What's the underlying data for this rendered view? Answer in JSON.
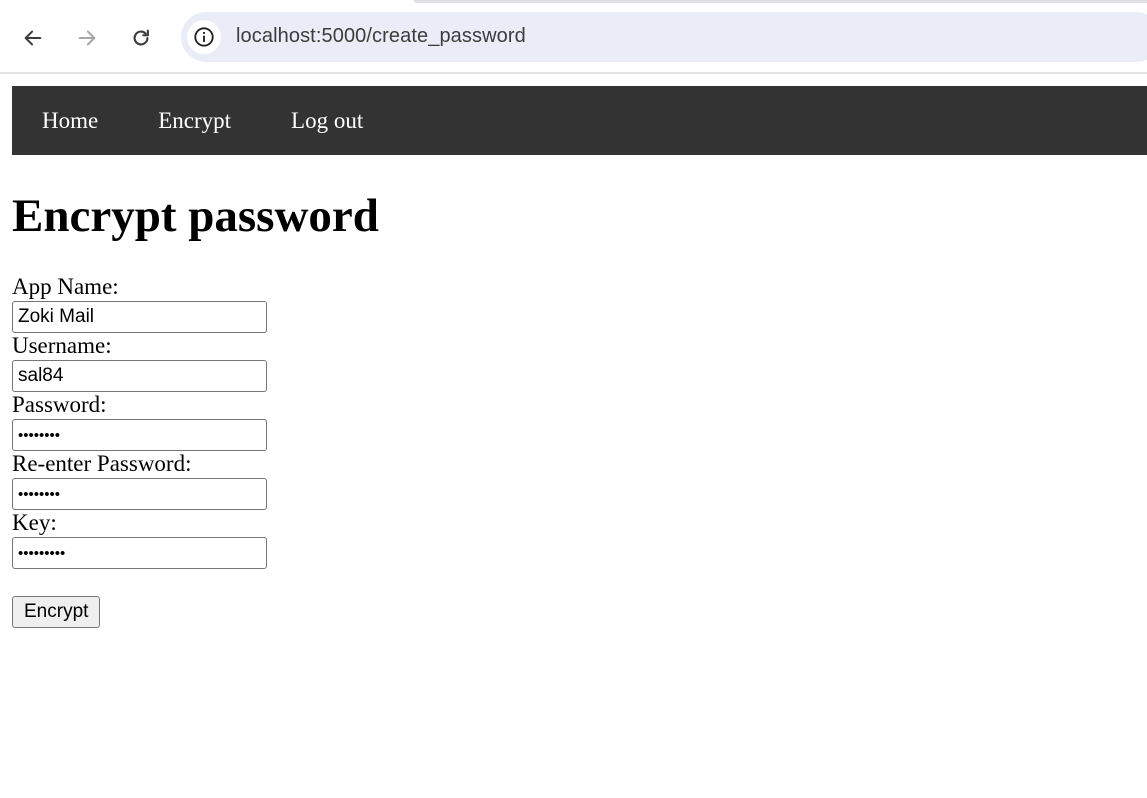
{
  "browser": {
    "url": "localhost:5000/create_password",
    "back_icon": "arrow-left-icon",
    "forward_icon": "arrow-right-icon",
    "reload_icon": "reload-icon",
    "site_info_icon": "info-circle-icon"
  },
  "nav": {
    "items": [
      {
        "label": "Home"
      },
      {
        "label": "Encrypt"
      },
      {
        "label": "Log out"
      }
    ],
    "background": "#333333"
  },
  "page": {
    "title": "Encrypt password"
  },
  "form": {
    "app_name": {
      "label": "App Name:",
      "value": "Zoki Mail"
    },
    "username": {
      "label": "Username:",
      "value": "sal84"
    },
    "password": {
      "label": "Password:",
      "value": "••••••••"
    },
    "reenter_password": {
      "label": "Re-enter Password:",
      "value": "••••••••"
    },
    "key": {
      "label": "Key:",
      "value": "•••••••••"
    },
    "submit_label": "Encrypt"
  }
}
